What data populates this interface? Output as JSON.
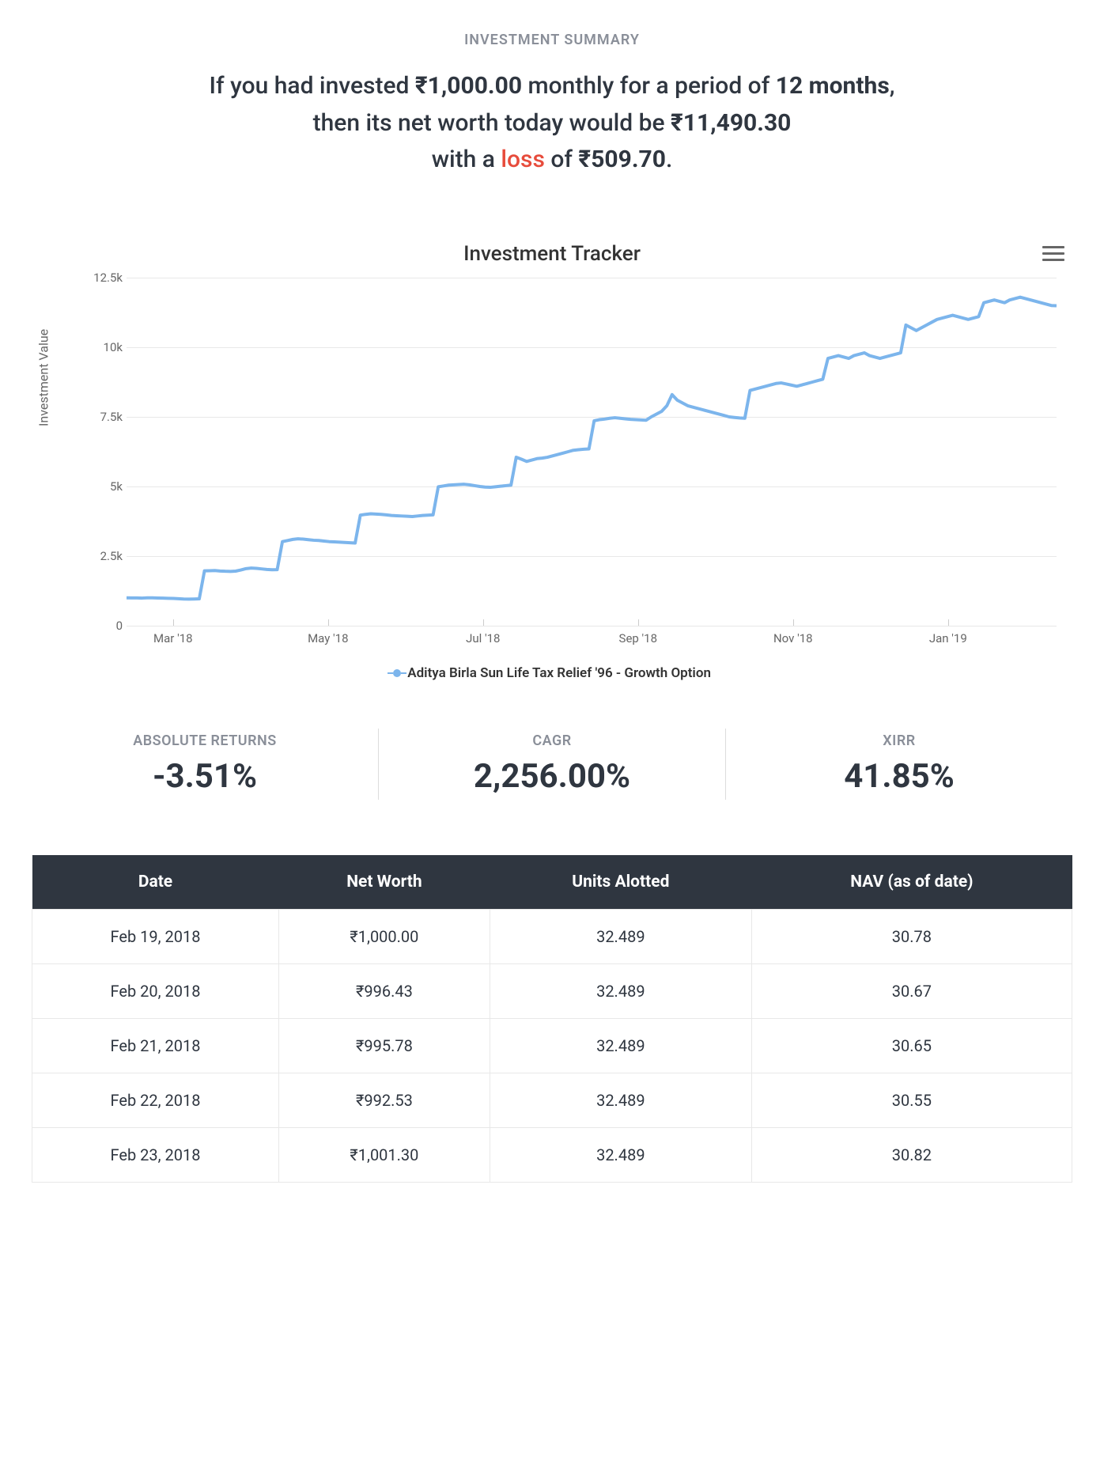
{
  "summary": {
    "label": "INVESTMENT SUMMARY",
    "line1_a": "If you had invested ",
    "line1_b": "₹1,000.00",
    "line1_c": " monthly for a period of ",
    "line1_d": "12 months",
    "line1_e": ",",
    "line2_a": "then its net worth today would be ",
    "line2_b": "₹11,490.30",
    "line3_a": "with a ",
    "line3_loss": "loss",
    "line3_b": " of ",
    "line3_c": "₹509.70",
    "line3_d": "."
  },
  "chart_title": "Investment Tracker",
  "chart_legend": "Aditya Birla Sun Life Tax Relief '96 - Growth Option",
  "chart_yaxis": "Investment Value",
  "chart_data": {
    "type": "line",
    "title": "Investment Tracker",
    "xlabel": "",
    "ylabel": "Investment Value",
    "ylim": [
      0,
      12500
    ],
    "y_ticks": [
      0,
      2500,
      5000,
      7500,
      10000,
      12500
    ],
    "y_tick_labels": [
      "0",
      "2.5k",
      "5k",
      "7.5k",
      "10k",
      "12.5k"
    ],
    "x_tick_labels": [
      "Mar '18",
      "May '18",
      "Jul '18",
      "Sep '18",
      "Nov '18",
      "Jan '19"
    ],
    "series": [
      {
        "name": "Aditya Birla Sun Life Tax Relief '96 - Growth Option",
        "color": "#7cb5ec",
        "values": [
          1000,
          996,
          996,
          993,
          1001,
          1000,
          995,
          990,
          985,
          980,
          970,
          960,
          955,
          960,
          965,
          1970,
          1975,
          1980,
          1965,
          1955,
          1950,
          1960,
          2000,
          2050,
          2070,
          2060,
          2040,
          2020,
          2010,
          2015,
          3020,
          3060,
          3100,
          3120,
          3110,
          3090,
          3070,
          3060,
          3040,
          3020,
          3010,
          3000,
          2990,
          2980,
          2970,
          3970,
          4000,
          4020,
          4010,
          4000,
          3980,
          3960,
          3950,
          3940,
          3930,
          3920,
          3940,
          3960,
          3970,
          3980,
          4990,
          5020,
          5050,
          5060,
          5070,
          5080,
          5060,
          5030,
          5000,
          4980,
          4970,
          4990,
          5010,
          5030,
          5050,
          6050,
          5980,
          5900,
          5950,
          6000,
          6020,
          6050,
          6100,
          6150,
          6200,
          6250,
          6300,
          6320,
          6340,
          6350,
          7360,
          7400,
          7420,
          7450,
          7470,
          7450,
          7430,
          7410,
          7400,
          7390,
          7380,
          7500,
          7600,
          7700,
          7900,
          8300,
          8100,
          8000,
          7900,
          7850,
          7800,
          7750,
          7700,
          7650,
          7600,
          7550,
          7500,
          7480,
          7460,
          7450,
          8450,
          8500,
          8550,
          8600,
          8650,
          8700,
          8720,
          8680,
          8640,
          8600,
          8650,
          8700,
          8750,
          8800,
          8850,
          9600,
          9650,
          9700,
          9650,
          9600,
          9700,
          9750,
          9800,
          9700,
          9650,
          9600,
          9650,
          9700,
          9750,
          9800,
          10800,
          10700,
          10600,
          10700,
          10800,
          10900,
          11000,
          11050,
          11100,
          11150,
          11100,
          11050,
          11000,
          11050,
          11100,
          11600,
          11650,
          11700,
          11650,
          11600,
          11700,
          11750,
          11800,
          11750,
          11700,
          11650,
          11600,
          11550,
          11500,
          11490
        ]
      }
    ]
  },
  "metrics": [
    {
      "label": "ABSOLUTE RETURNS",
      "value": "-3.51%"
    },
    {
      "label": "CAGR",
      "value": "2,256.00%"
    },
    {
      "label": "XIRR",
      "value": "41.85%"
    }
  ],
  "table": {
    "headers": [
      "Date",
      "Net Worth",
      "Units Alotted",
      "NAV (as of date)"
    ],
    "rows": [
      [
        "Feb 19, 2018",
        "₹1,000.00",
        "32.489",
        "30.78"
      ],
      [
        "Feb 20, 2018",
        "₹996.43",
        "32.489",
        "30.67"
      ],
      [
        "Feb 21, 2018",
        "₹995.78",
        "32.489",
        "30.65"
      ],
      [
        "Feb 22, 2018",
        "₹992.53",
        "32.489",
        "30.55"
      ],
      [
        "Feb 23, 2018",
        "₹1,001.30",
        "32.489",
        "30.82"
      ]
    ]
  }
}
